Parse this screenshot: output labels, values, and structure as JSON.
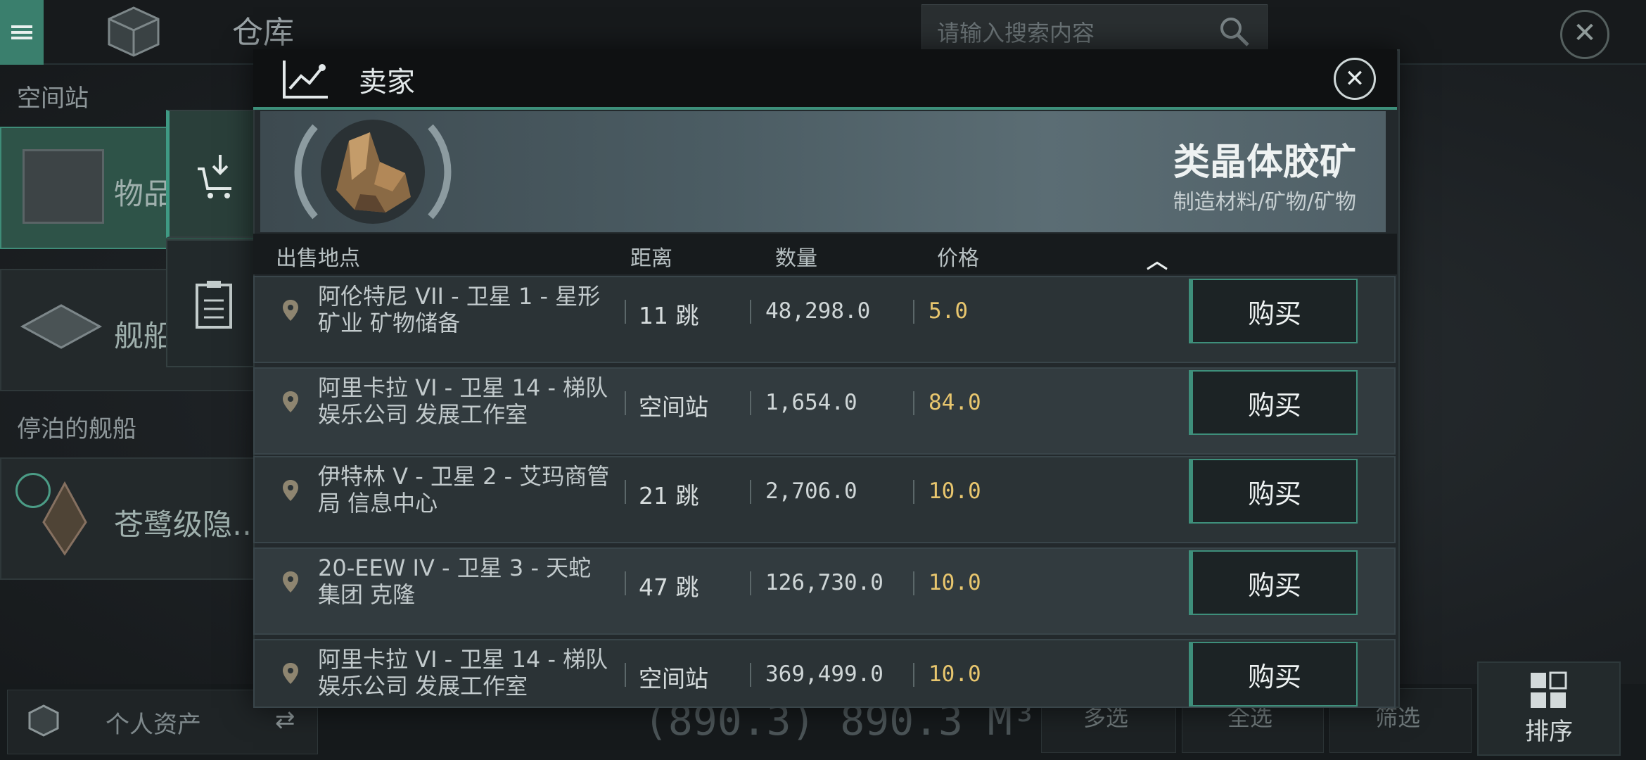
{
  "background": {
    "title": "仓库",
    "search_placeholder": "请输入搜索内容",
    "sidebar": {
      "section_station": "空间站",
      "items_label": "物品",
      "ships_label": "舰船",
      "section_docked": "停泊的舰船",
      "docked_ship_label": "苍鹭级隐…"
    },
    "bottom": {
      "assets_label": "个人资产",
      "volume": "(890.3) 890.3 M³",
      "tab_multi": "多选",
      "tab_all": "全选",
      "tab_filter": "筛选",
      "sort_label": "排序"
    }
  },
  "modal": {
    "title": "卖家",
    "item": {
      "name": "类晶体胶矿",
      "category": "制造材料/矿物/矿物"
    },
    "columns": {
      "location": "出售地点",
      "distance": "距离",
      "quantity": "数量",
      "price": "价格"
    },
    "buy_label": "购买",
    "rows": [
      {
        "location": "阿伦特尼 VII - 卫星 1 - 星形矿业 矿物储备",
        "distance": "11 跳",
        "quantity": "48,298.0",
        "price": "5.0"
      },
      {
        "location": "阿里卡拉 VI - 卫星 14 - 梯队娱乐公司 发展工作室",
        "distance": "空间站",
        "quantity": "1,654.0",
        "price": "84.0"
      },
      {
        "location": "伊特林 V - 卫星 2 - 艾玛商管局 信息中心",
        "distance": "21 跳",
        "quantity": "2,706.0",
        "price": "10.0"
      },
      {
        "location": "20-EEW IV - 卫星 3 - 天蛇集团 克隆",
        "distance": "47 跳",
        "quantity": "126,730.0",
        "price": "10.0"
      },
      {
        "location": "阿里卡拉 VI - 卫星 14 - 梯队娱乐公司 发展工作室",
        "distance": "空间站",
        "quantity": "369,499.0",
        "price": "10.0"
      }
    ]
  }
}
